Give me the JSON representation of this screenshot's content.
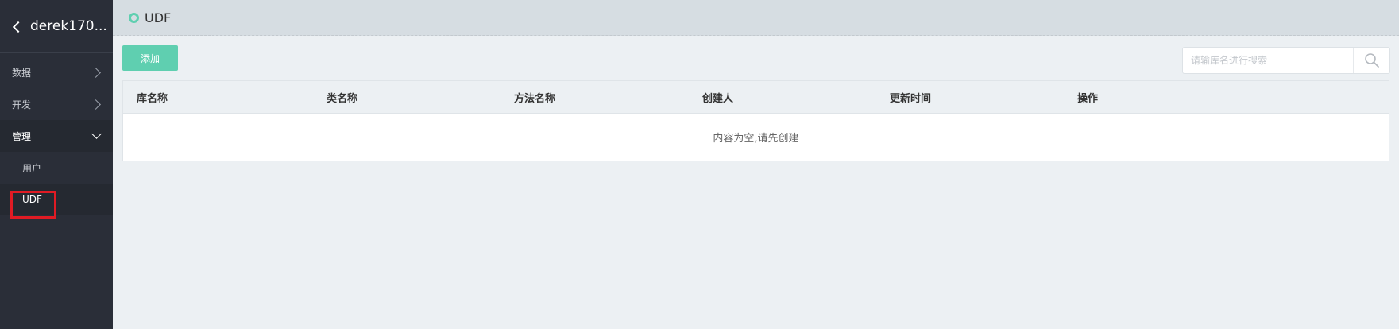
{
  "sidebar": {
    "project": "derek170...",
    "items": [
      {
        "label": "数据"
      },
      {
        "label": "开发"
      },
      {
        "label": "管理"
      }
    ],
    "sub_items": [
      {
        "label": "用户"
      },
      {
        "label": "UDF"
      }
    ]
  },
  "topbar": {
    "title": "UDF"
  },
  "toolbar": {
    "add_label": "添加"
  },
  "search": {
    "placeholder": "请输库名进行搜索",
    "value": ""
  },
  "table": {
    "columns": [
      "库名称",
      "类名称",
      "方法名称",
      "创建人",
      "更新时间",
      "操作"
    ],
    "empty_text": "内容为空,请先创建"
  },
  "colors": {
    "accent": "#5fcfb0",
    "sidebar_bg": "#2a2e38",
    "highlight": "#e01b24"
  }
}
